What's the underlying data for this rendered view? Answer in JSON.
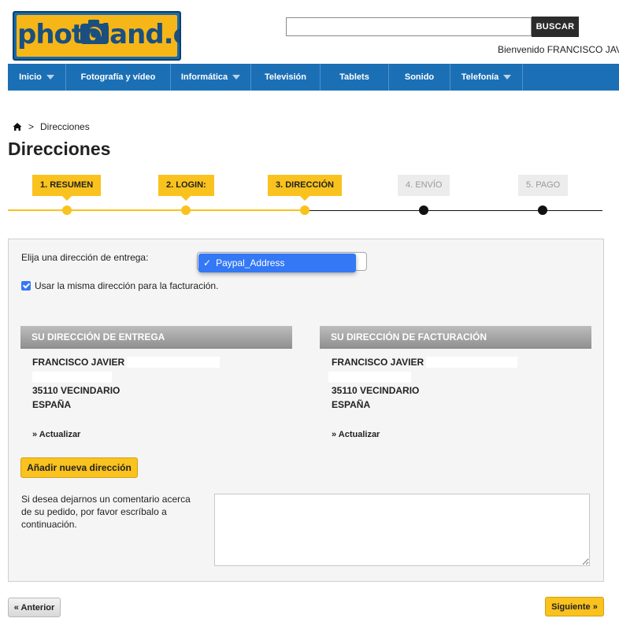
{
  "header": {
    "logo_text": "photoland.es",
    "search": {
      "value": "",
      "placeholder": "",
      "button_label": "BUSCAR"
    },
    "welcome": "Bienvenido FRANCISCO JAVIER"
  },
  "nav": {
    "items": [
      {
        "label": "Inicio",
        "has_dropdown": true
      },
      {
        "label": "Fotografía y vídeo",
        "has_dropdown": false
      },
      {
        "label": "Informática",
        "has_dropdown": true
      },
      {
        "label": "Televisión",
        "has_dropdown": false
      },
      {
        "label": "Tablets",
        "has_dropdown": false
      },
      {
        "label": "Sonido",
        "has_dropdown": false
      },
      {
        "label": "Telefonía",
        "has_dropdown": true
      }
    ]
  },
  "breadcrumb": {
    "separator": ">",
    "current": "Direcciones"
  },
  "page_title": "Direcciones",
  "steps": [
    {
      "label": "1. RESUMEN",
      "state": "done"
    },
    {
      "label": "2. LOGIN:",
      "state": "done"
    },
    {
      "label": "3. DIRECCIÓN",
      "state": "current"
    },
    {
      "label": "4. ENVÍO",
      "state": "pending"
    },
    {
      "label": "5. PAGO",
      "state": "pending"
    }
  ],
  "address_form": {
    "delivery_label": "Elija una dirección de entrega:",
    "delivery_selected": "Paypal_Address",
    "same_address_label": "Usar la misma dirección para la facturación.",
    "same_address_checked": true,
    "delivery_box": {
      "title": "SU DIRECCIÓN DE ENTREGA",
      "name": "FRANCISCO JAVIER",
      "city": "35110 VECINDARIO",
      "country": "ESPAÑA",
      "update_label": "» Actualizar"
    },
    "billing_box": {
      "title": "SU DIRECCIÓN DE FACTURACIÓN",
      "name": "FRANCISCO JAVIER",
      "city": "35110 VECINDARIO",
      "country": "ESPAÑA",
      "update_label": "» Actualizar"
    },
    "add_button_label": "Añadir nueva dirección",
    "comment_prompt": "Si desea dejarnos un comentario acerca de su pedido, por favor escríbalo a continuación.",
    "comment_value": ""
  },
  "footer_nav": {
    "prev_label": "« Anterior",
    "next_label": "Siguiente »"
  },
  "colors": {
    "brand_blue": "#1b6fb5",
    "accent_yellow": "#f9c21e",
    "logo_yellow": "#f7b617"
  }
}
